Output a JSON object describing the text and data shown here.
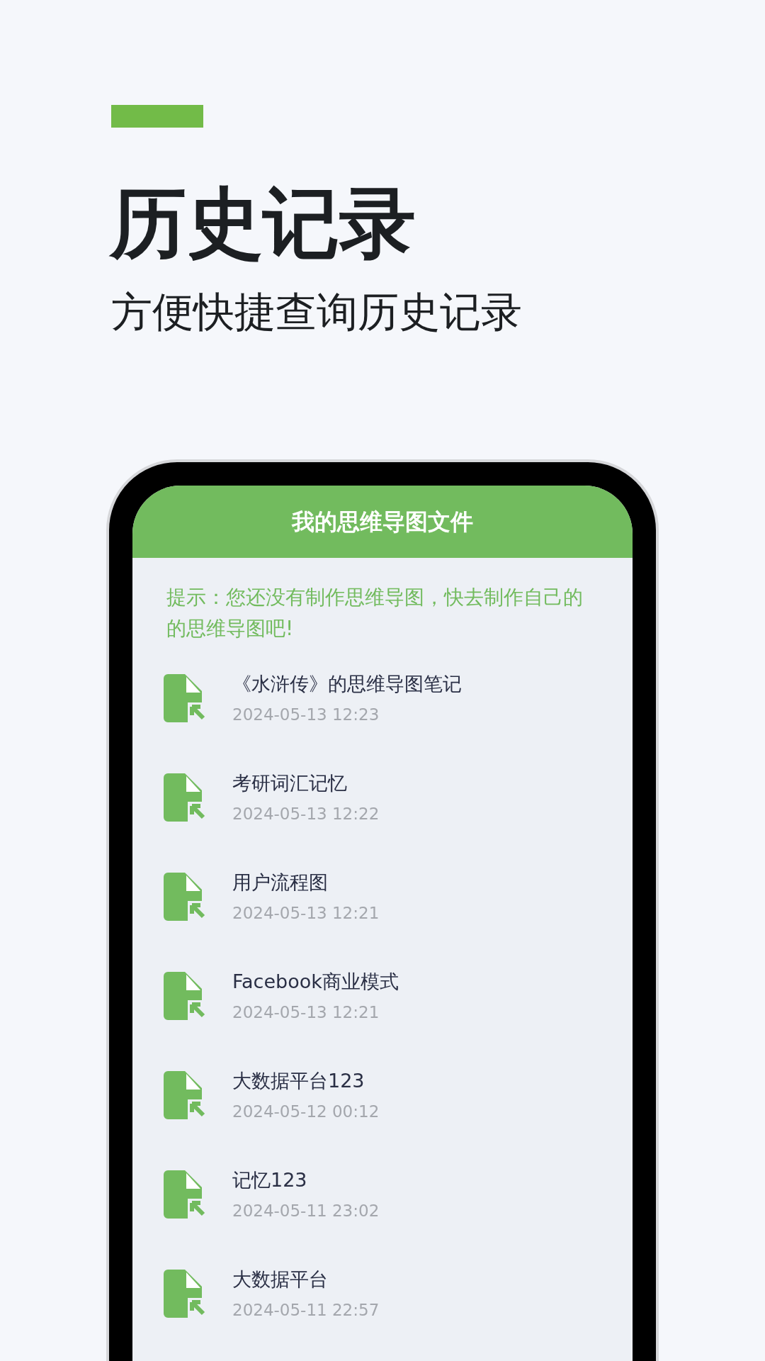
{
  "heading": {
    "title": "历史记录",
    "subtitle": "方便快捷查询历史记录"
  },
  "app": {
    "title": "我的思维导图文件",
    "hint": "提示：您还没有制作思维导图，快去制作自己的的思维导图吧!",
    "files": [
      {
        "name": "《水浒传》的思维导图笔记",
        "time": "2024-05-13 12:23"
      },
      {
        "name": "考研词汇记忆",
        "time": "2024-05-13 12:22"
      },
      {
        "name": "用户流程图",
        "time": "2024-05-13 12:21"
      },
      {
        "name": "Facebook商业模式",
        "time": "2024-05-13 12:21"
      },
      {
        "name": "大数据平台123",
        "time": "2024-05-12 00:12"
      },
      {
        "name": "记忆123",
        "time": "2024-05-11 23:02"
      },
      {
        "name": "大数据平台",
        "time": "2024-05-11 22:57"
      }
    ]
  }
}
